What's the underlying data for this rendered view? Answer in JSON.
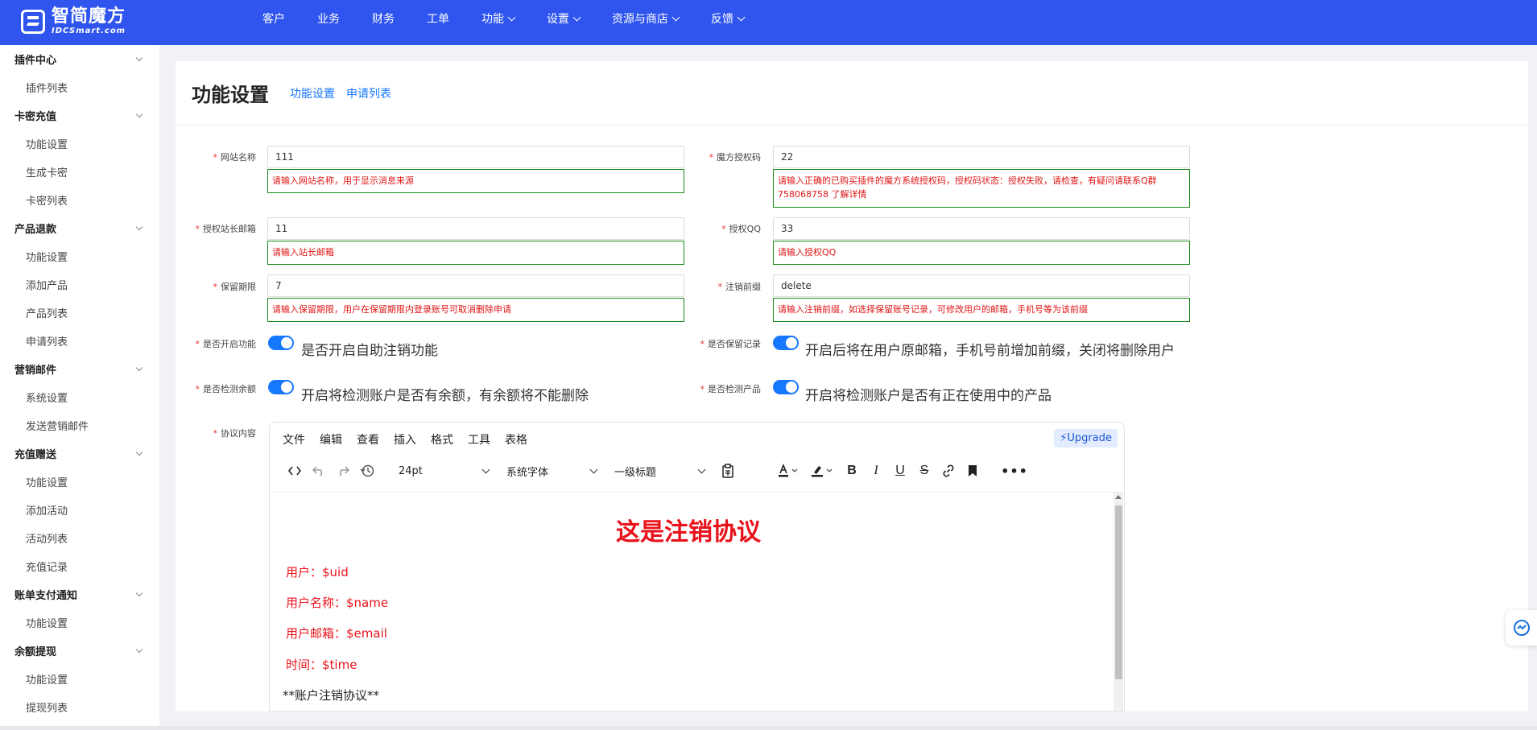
{
  "brand": {
    "name_cn": "智简魔方",
    "name_en": "IDCSmart.com"
  },
  "topnav": [
    {
      "label": "客户",
      "dropdown": false
    },
    {
      "label": "业务",
      "dropdown": false
    },
    {
      "label": "财务",
      "dropdown": false
    },
    {
      "label": "工单",
      "dropdown": false
    },
    {
      "label": "功能",
      "dropdown": true
    },
    {
      "label": "设置",
      "dropdown": true
    },
    {
      "label": "资源与商店",
      "dropdown": true
    },
    {
      "label": "反馈",
      "dropdown": true
    }
  ],
  "sidebar": [
    {
      "title": "插件中心",
      "items": [
        "插件列表"
      ]
    },
    {
      "title": "卡密充值",
      "items": [
        "功能设置",
        "生成卡密",
        "卡密列表"
      ]
    },
    {
      "title": "产品退款",
      "items": [
        "功能设置",
        "添加产品",
        "产品列表",
        "申请列表"
      ]
    },
    {
      "title": "营销邮件",
      "items": [
        "系统设置",
        "发送营销邮件"
      ]
    },
    {
      "title": "充值赠送",
      "items": [
        "功能设置",
        "添加活动",
        "活动列表",
        "充值记录"
      ]
    },
    {
      "title": "账单支付通知",
      "items": [
        "功能设置"
      ]
    },
    {
      "title": "余额提现",
      "items": [
        "功能设置",
        "提现列表"
      ]
    }
  ],
  "page": {
    "title": "功能设置",
    "tabs": [
      "功能设置",
      "申请列表"
    ]
  },
  "form": {
    "site_name": {
      "label": "网站名称",
      "value": "111",
      "hint": "请输入网站名称，用于显示消息来源"
    },
    "license_code": {
      "label": "魔方授权码",
      "value": "22",
      "hint": "请输入正确的已购买插件的魔方系统授权码，授权码状态：授权失败，请检查，有疑问请联系Q群758068758 了解详情"
    },
    "admin_email": {
      "label": "授权站长邮箱",
      "value": "11",
      "hint": "请输入站长邮箱"
    },
    "license_qq": {
      "label": "授权QQ",
      "value": "33",
      "hint": "请输入授权QQ"
    },
    "retention_period": {
      "label": "保留期限",
      "value": "7",
      "hint": "请输入保留期限，用户在保留期限内登录账号可取消删除申请"
    },
    "cancel_prefix": {
      "label": "注销前缀",
      "value": "delete",
      "hint": "请输入注销前缀，如选择保留账号记录，可修改用户的邮箱，手机号等为该前缀"
    },
    "enable_feature": {
      "label": "是否开启功能",
      "enabled": true,
      "text": "是否开启自助注销功能"
    },
    "keep_record": {
      "label": "是否保留记录",
      "enabled": true,
      "text": "开启后将在用户原邮箱，手机号前增加前缀，关闭将删除用户"
    },
    "check_balance": {
      "label": "是否检测余额",
      "enabled": true,
      "text": "开启将检测账户是否有余额，有余额将不能删除"
    },
    "check_product": {
      "label": "是否检测产品",
      "enabled": true,
      "text": "开启将检测账户是否有正在使用中的产品"
    },
    "agreement_label": "协议内容"
  },
  "editor": {
    "menus": [
      "文件",
      "编辑",
      "查看",
      "插入",
      "格式",
      "工具",
      "表格"
    ],
    "upgrade": "⚡Upgrade",
    "font_size": "24pt",
    "font_family": "系统字体",
    "block_format": "一级标题",
    "content": {
      "heading": "这是注销协议",
      "lines": [
        "用户：$uid",
        "用户名称：$name",
        "用户邮箱：$email",
        "时间：$time"
      ],
      "footer": "**账户注销协议**"
    }
  }
}
